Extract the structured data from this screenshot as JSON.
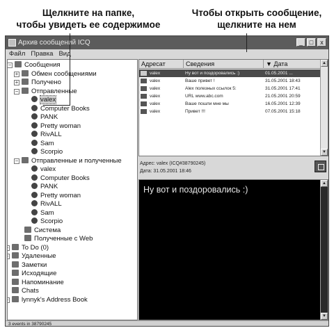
{
  "callouts": {
    "left": [
      "Щелкните на папке,",
      "чтобы увидеть ее содержимое"
    ],
    "right": [
      "Чтобы открыть сообщение,",
      "щелкните на нем"
    ]
  },
  "window": {
    "title": "Архив сообщений ICQ",
    "menu": [
      "Файл",
      "Правка",
      "Вид"
    ],
    "buttons": [
      "_",
      "□",
      "x"
    ]
  },
  "tree": [
    {
      "label": "Сообщения",
      "icon": "folder-icon",
      "expander": "−"
    },
    {
      "label": "Обмен сообщениями",
      "icon": "chat-icon",
      "expander": "+"
    },
    {
      "label": "Получено",
      "icon": "folder-icon",
      "expander": "+"
    },
    {
      "label": "Отправленные",
      "icon": "folder-icon",
      "expander": "−"
    },
    {
      "label": "valex",
      "icon": "user-icon",
      "selected": true
    },
    {
      "label": "Computer Books",
      "icon": "user-icon"
    },
    {
      "label": "PANK",
      "icon": "user-icon"
    },
    {
      "label": "Pretty woman",
      "icon": "user-icon"
    },
    {
      "label": "RivALL",
      "icon": "user-icon"
    },
    {
      "label": "Sam",
      "icon": "user-icon"
    },
    {
      "label": "Scorpio",
      "icon": "user-icon"
    },
    {
      "label": "Отправленные и полученные",
      "icon": "folder-icon",
      "expander": "−"
    },
    {
      "label": "valex",
      "icon": "user-icon"
    },
    {
      "label": "Computer Books",
      "icon": "user-icon"
    },
    {
      "label": "PANK",
      "icon": "user-icon"
    },
    {
      "label": "Pretty woman",
      "icon": "user-icon"
    },
    {
      "label": "RivALL",
      "icon": "user-icon"
    },
    {
      "label": "Sam",
      "icon": "user-icon"
    },
    {
      "label": "Scorpio",
      "icon": "user-icon"
    },
    {
      "label": "Система",
      "icon": "system-icon"
    },
    {
      "label": "Полученные с Web",
      "icon": "web-icon"
    },
    {
      "label": "To Do (0)",
      "icon": "todo-icon",
      "expander": "+"
    },
    {
      "label": "Удаленные",
      "icon": "trash-icon",
      "expander": "+"
    },
    {
      "label": "Заметки",
      "icon": "notes-icon"
    },
    {
      "label": "Исходящие",
      "icon": "outbox-icon"
    },
    {
      "label": "Напоминание",
      "icon": "reminder-icon"
    },
    {
      "label": "Chats",
      "icon": "chats-icon"
    },
    {
      "label": "lynnyk's Address Book",
      "icon": "addressbook-icon",
      "expander": "+"
    }
  ],
  "list": {
    "columns": [
      "Адресат",
      "Сведения",
      "▼ Дата"
    ],
    "rows": [
      {
        "to": "valex",
        "info": "Ну вот и поздоровались :)",
        "date": "01.05.2001 ...",
        "selected": true
      },
      {
        "to": "valex",
        "info": "Ваше привет !",
        "date": "31.05.2001 18:43"
      },
      {
        "to": "valex",
        "info": "Alex полезных ссылок 5:",
        "date": "31.05.2001 17:41"
      },
      {
        "to": "valex",
        "info": "URL www.abc.com",
        "date": "21.05.2001 20:59"
      },
      {
        "to": "valex",
        "info": "Ваше пошли мне мы",
        "date": "16.05.2001 12:39"
      },
      {
        "to": "valex",
        "info": "Привет !!!",
        "date": "07.05.2001 15:18"
      }
    ]
  },
  "header": {
    "address": "Адрес: valex (ICQ#38790245)",
    "date": "Дата: 31.05.2001 18:46"
  },
  "message": {
    "text": "Ну вот и поздоровались :)"
  },
  "status": {
    "text": "3 events in 38790245"
  },
  "colors": {
    "titlebar": "#5c5c5c",
    "window": "#d8d8d8",
    "message_bg": "#000000",
    "selection": "#4a4a4a"
  }
}
